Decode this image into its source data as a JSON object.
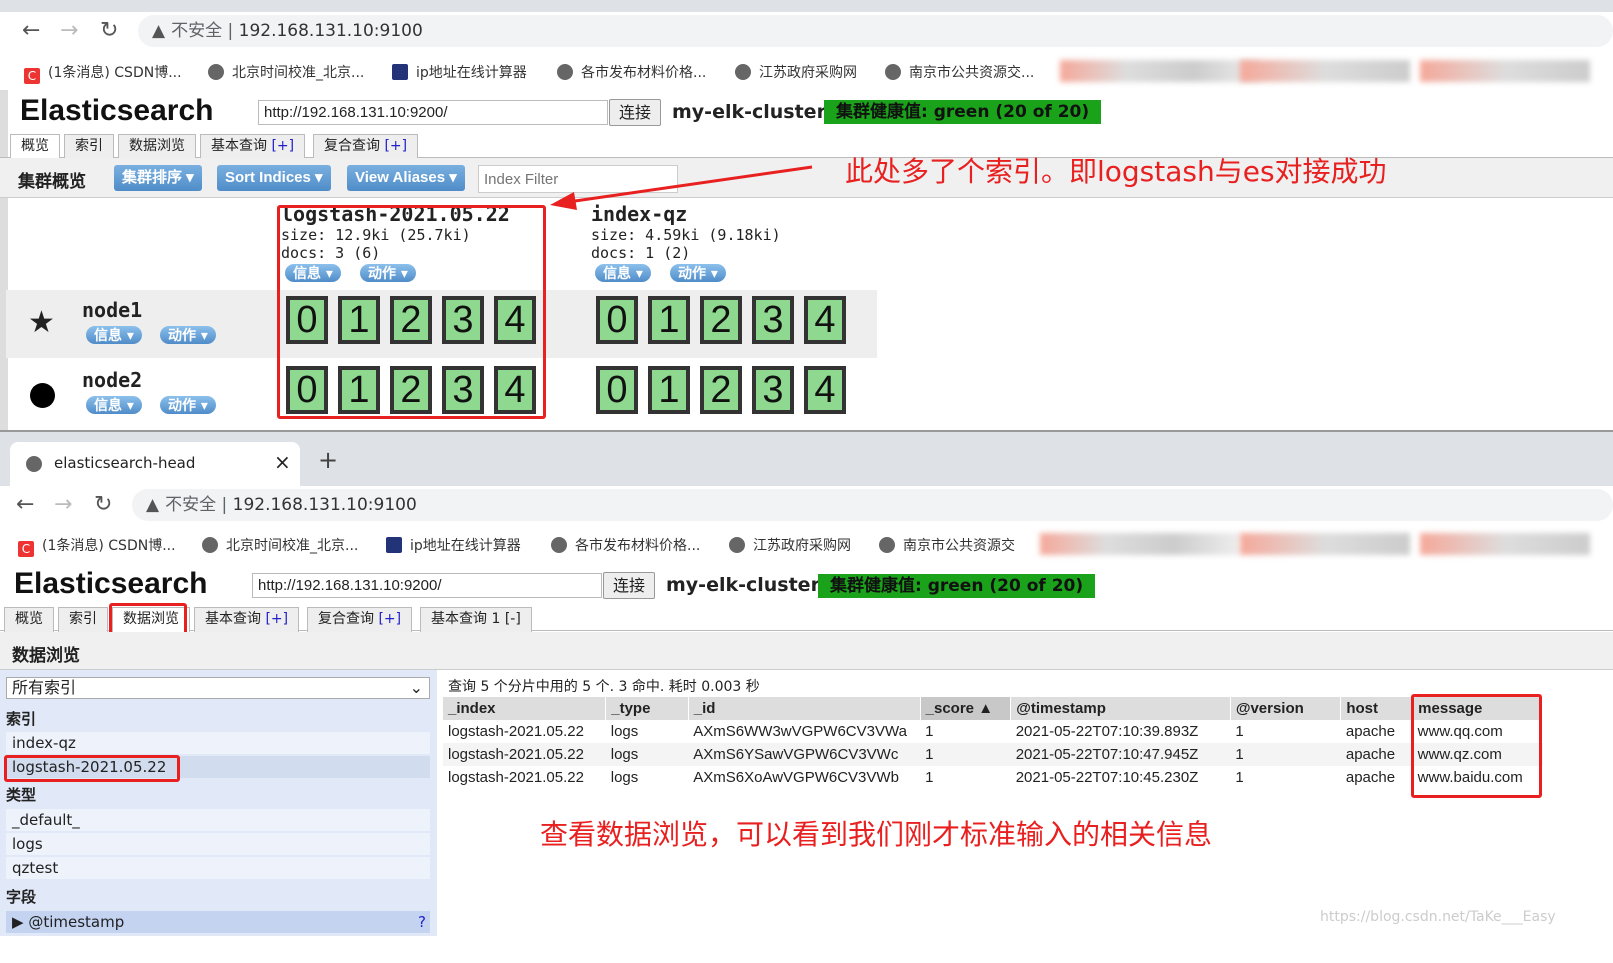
{
  "browser": {
    "insecure_label": "不安全",
    "url": "192.168.131.10:9100",
    "tab_title": "elasticsearch-head",
    "bookmarks": [
      "(1条消息) CSDN博...",
      "北京时间校准_北京...",
      "ip地址在线计算器",
      "各市发布材料价格...",
      "江苏政府采购网",
      "南京市公共资源交..."
    ],
    "bookmarks_bottom_last": "南京市公共资源交"
  },
  "es": {
    "title": "Elasticsearch",
    "connect_url": "http://192.168.131.10:9200/",
    "connect_label": "连接",
    "cluster_name": "my-elk-cluster",
    "health": "集群健康值: green (20 of 20)",
    "health_color": "#1aa31a",
    "tabs": [
      "概览",
      "索引",
      "数据浏览",
      "基本查询",
      "复合查询"
    ],
    "tab_plus": "[+]",
    "extra_tab": "基本查询 1",
    "extra_tab_minus": "[-]"
  },
  "overview": {
    "heading": "集群概览",
    "sort_cluster": "集群排序",
    "sort_indices": "Sort Indices",
    "view_aliases": "View Aliases",
    "index_filter_placeholder": "Index Filter",
    "info_label": "信息",
    "action_label": "动作",
    "indices": [
      {
        "name": "logstash-2021.05.22",
        "size": "size: 12.9ki (25.7ki)",
        "docs": "docs: 3 (6)"
      },
      {
        "name": "index-qz",
        "size": "size: 4.59ki (9.18ki)",
        "docs": "docs: 1 (2)"
      }
    ],
    "nodes": [
      {
        "name": "node1",
        "icon": "star"
      },
      {
        "name": "node2",
        "icon": "circle"
      }
    ],
    "shards": [
      "0",
      "1",
      "2",
      "3",
      "4"
    ],
    "annotation": "此处多了个索引。即logstash与es对接成功"
  },
  "browse": {
    "heading": "数据浏览",
    "index_select": "所有索引",
    "sec_index": "索引",
    "indices": [
      "index-qz",
      "logstash-2021.05.22"
    ],
    "sec_type": "类型",
    "types": [
      "_default_",
      "logs",
      "qztest"
    ],
    "sec_field": "字段",
    "fields": [
      "@timestamp"
    ],
    "field_help": "?",
    "summary": "查询 5 个分片中用的 5 个. 3 命中. 耗时 0.003 秒",
    "columns": [
      "_index",
      "_type",
      "_id",
      "_score ▲",
      "@timestamp",
      "@version",
      "host",
      "message"
    ],
    "rows": [
      [
        "logstash-2021.05.22",
        "logs",
        "AXmS6WW3wVGPW6CV3VWa",
        "1",
        "2021-05-22T07:10:39.893Z",
        "1",
        "apache",
        "www.qq.com"
      ],
      [
        "logstash-2021.05.22",
        "logs",
        "AXmS6YSawVGPW6CV3VWc",
        "1",
        "2021-05-22T07:10:47.945Z",
        "1",
        "apache",
        "www.qz.com"
      ],
      [
        "logstash-2021.05.22",
        "logs",
        "AXmS6XoAwVGPW6CV3VWb",
        "1",
        "2021-05-22T07:10:45.230Z",
        "1",
        "apache",
        "www.baidu.com"
      ]
    ],
    "annotation": "查看数据浏览，可以看到我们刚才标准输入的相关信息"
  },
  "watermark": "https://blog.csdn.net/TaKe___Easy"
}
